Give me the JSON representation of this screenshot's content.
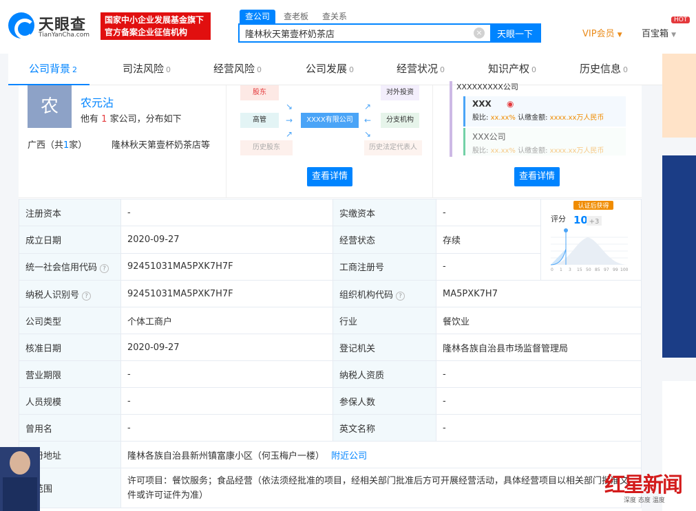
{
  "header": {
    "logo_title": "天眼查",
    "logo_sub": "TianYanCha.com",
    "badge_line1": "国家中小企业发展基金旗下",
    "badge_line2": "官方备案企业征信机构",
    "search_tabs": [
      "查公司",
      "查老板",
      "查关系"
    ],
    "search_value": "隆林秋天第壹杯奶茶店",
    "search_button": "天眼一下",
    "vip": "VIP会员",
    "baibao": "百宝箱",
    "hot": "HOT"
  },
  "nav": [
    {
      "label": "公司背景",
      "count": "2"
    },
    {
      "label": "司法风险",
      "count": "0"
    },
    {
      "label": "经营风险",
      "count": "0"
    },
    {
      "label": "公司发展",
      "count": "0"
    },
    {
      "label": "经营状况",
      "count": "0"
    },
    {
      "label": "知识产权",
      "count": "0"
    },
    {
      "label": "历史信息",
      "count": "0"
    }
  ],
  "person": {
    "avatar": "农",
    "name": "农元沾",
    "desc_pre": "他有",
    "desc_count": "1",
    "desc_post": "家公司，分布如下",
    "region_pre": "广西（共",
    "region_count": "1",
    "region_post": "家）",
    "company": "隆林秋天第壹杯奶茶店等"
  },
  "diagram": {
    "shareholder": "股东",
    "executive": "高管",
    "history_shareholder": "历史股东",
    "center": "XXXX有限公司",
    "invest": "对外投资",
    "branch": "分支机构",
    "history_rep": "历史法定代表人",
    "detail": "查看详情"
  },
  "tree": {
    "top": "XXXXXXXXX公司",
    "node1": "XXX",
    "ratio_label": "股比:",
    "ratio_value": "xx.xx%",
    "amount_label": "认缴金额:",
    "amount_value": "xxxx.xx万人民币",
    "node2": "XXX公司",
    "detail": "查看详情"
  },
  "score": {
    "badge": "认证后获得",
    "label": "评分",
    "value": "10",
    "plus": "+3",
    "ticks": [
      "0",
      "1",
      "3",
      "15",
      "50",
      "85",
      "97",
      "99",
      "100"
    ]
  },
  "info_rows": [
    [
      "注册资本",
      "-",
      "实缴资本",
      "-"
    ],
    [
      "成立日期",
      "2020-09-27",
      "经营状态",
      "存续"
    ],
    [
      "统一社会信用代码",
      "92451031MA5PXK7H7F",
      "工商注册号",
      "-"
    ],
    [
      "纳税人识别号",
      "92451031MA5PXK7H7F",
      "组织机构代码",
      "MA5PXK7H7"
    ],
    [
      "公司类型",
      "个体工商户",
      "行业",
      "餐饮业"
    ],
    [
      "核准日期",
      "2020-09-27",
      "登记机关",
      "隆林各族自治县市场监督管理局"
    ],
    [
      "营业期限",
      "-",
      "纳税人资质",
      "-"
    ],
    [
      "人员规模",
      "-",
      "参保人数",
      "-"
    ],
    [
      "曾用名",
      "-",
      "英文名称",
      "-"
    ]
  ],
  "address": {
    "label": "注册地址",
    "value": "隆林各族自治县新州镇富康小区（何玉梅户一楼）",
    "link": "附近公司"
  },
  "scope": {
    "label": "营范围",
    "value": "许可项目：餐饮服务；食品经营（依法须经批准的项目，经相关部门批准后方可开展经营活动，具体经营项目以相关部门批准文件或许可证件为准）"
  },
  "watermark": {
    "title": "红星新闻",
    "sub": "深度 态度 温度"
  }
}
